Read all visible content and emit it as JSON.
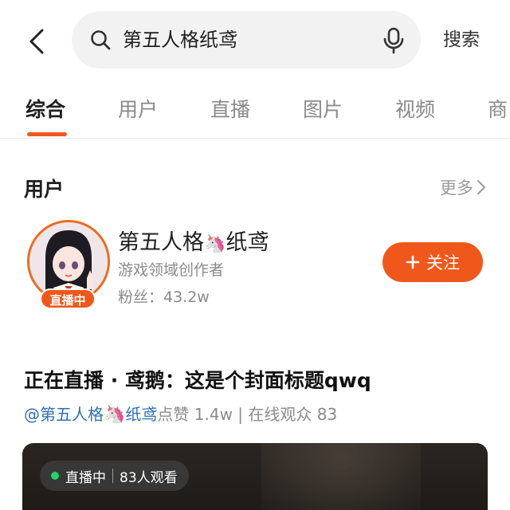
{
  "search": {
    "query": "第五人格纸鸢",
    "button_label": "搜索"
  },
  "tabs": [
    {
      "label": "综合",
      "active": true
    },
    {
      "label": "用户",
      "active": false
    },
    {
      "label": "直播",
      "active": false
    },
    {
      "label": "图片",
      "active": false
    },
    {
      "label": "视频",
      "active": false
    },
    {
      "label": "商",
      "active": false
    }
  ],
  "users_section": {
    "title": "用户",
    "more_label": "更多"
  },
  "user": {
    "name_prefix": "第五人格",
    "name_emoji": "🦄",
    "name_suffix": "纸鸢",
    "subtitle": "游戏领域创作者",
    "fans": "粉丝：43.2w",
    "live_badge": "直播中",
    "follow_label": "关注"
  },
  "live": {
    "title": "正在直播 · 鸢鹅：这是个封面标题qwq",
    "author_prefix": "@第五人格",
    "author_emoji": "🦄",
    "author_suffix": "纸鸢",
    "stats": "点赞 1.4w | 在线观众 83",
    "chip_status": "直播中",
    "chip_viewers": "83人观看"
  },
  "colors": {
    "accent": "#f0581b",
    "link": "#2f6fb4",
    "live_dot": "#22d36b"
  }
}
